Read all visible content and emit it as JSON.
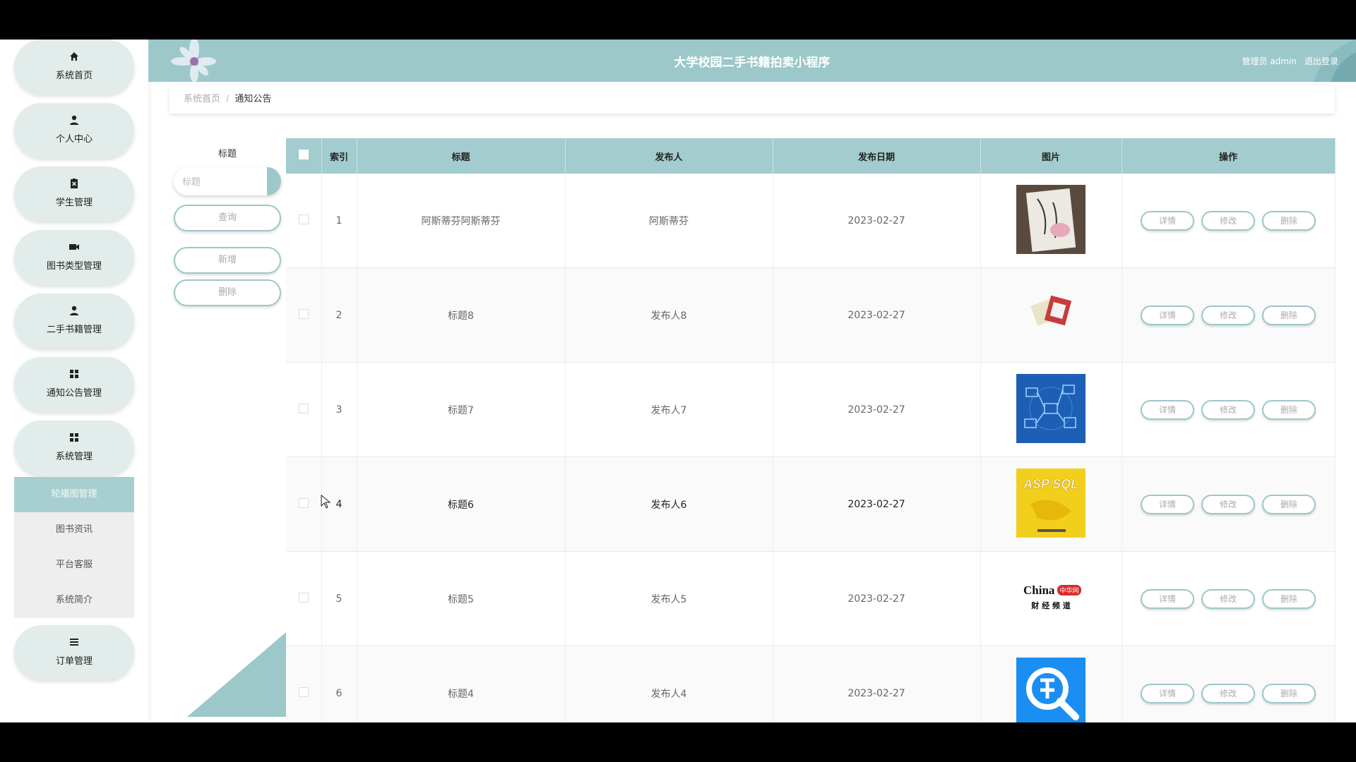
{
  "app": {
    "title": "大学校园二手书籍拍卖小程序",
    "user_label": "管理员 admin",
    "logout_label": "退出登录"
  },
  "sidebar": {
    "items": [
      {
        "label": "系统首页",
        "icon": "home-icon"
      },
      {
        "label": "个人中心",
        "icon": "user-icon"
      },
      {
        "label": "学生管理",
        "icon": "clipboard-icon"
      },
      {
        "label": "图书类型管理",
        "icon": "video-icon"
      },
      {
        "label": "二手书籍管理",
        "icon": "user-icon"
      },
      {
        "label": "通知公告管理",
        "icon": "grid-icon"
      },
      {
        "label": "系统管理",
        "icon": "grid-icon"
      }
    ],
    "submenu": [
      "轮播图管理",
      "图书资讯",
      "平台客服",
      "系统简介"
    ],
    "active_submenu_index": 0,
    "last_item": {
      "label": "订单管理",
      "icon": "list-icon"
    }
  },
  "breadcrumb": {
    "home": "系统首页",
    "separator": "/",
    "current": "通知公告"
  },
  "search": {
    "label": "标题",
    "placeholder": "标题",
    "query_button": "查询",
    "add_button": "新增",
    "delete_button": "删除"
  },
  "table": {
    "columns": [
      "索引",
      "标题",
      "发布人",
      "发布日期",
      "图片",
      "操作"
    ],
    "rows": [
      {
        "index": "1",
        "title": "阿斯蒂芬阿斯蒂芬",
        "publisher": "阿斯蒂芬",
        "date": "2023-02-27",
        "image": "book-cover-novel"
      },
      {
        "index": "2",
        "title": "标题8",
        "publisher": "发布人8",
        "date": "2023-02-27",
        "image": "book-stack"
      },
      {
        "index": "3",
        "title": "标题7",
        "publisher": "发布人7",
        "date": "2023-02-27",
        "image": "network-diagram"
      },
      {
        "index": "4",
        "title": "标题6",
        "publisher": "发布人6",
        "date": "2023-02-27",
        "image": "asp-sql-book"
      },
      {
        "index": "5",
        "title": "标题5",
        "publisher": "发布人5",
        "date": "2023-02-27",
        "image": "china-logo"
      },
      {
        "index": "6",
        "title": "标题4",
        "publisher": "发布人4",
        "date": "2023-02-27",
        "image": "search-app-icon"
      }
    ],
    "row_actions": {
      "detail": "详情",
      "edit": "修改",
      "delete": "删除"
    },
    "china_logo_text": {
      "brand": "China",
      "badge": "中华网",
      "sub": "财 经 频 道"
    },
    "asp_sql_text": "ASP SQL"
  },
  "colors": {
    "accent": "#9cc8c9",
    "header_bg": "#a2cccd",
    "submenu_active": "#a8cfd0"
  }
}
